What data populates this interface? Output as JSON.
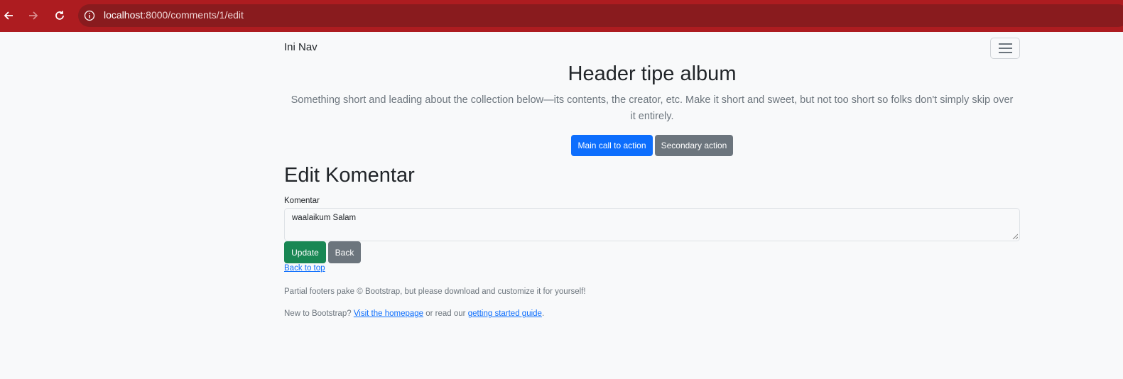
{
  "browser": {
    "url_host": "localhost",
    "url_path": ":8000/comments/1/edit"
  },
  "navbar": {
    "brand": "Ini Nav"
  },
  "hero": {
    "title": "Header tipe album",
    "lead_line1": "Something short and leading about the collection below—its contents, the creator, etc. Make it short and sweet, but not too short so folks don't simply skip over",
    "lead_line2": "it entirely.",
    "primary_label": "Main call to action",
    "secondary_label": "Secondary action"
  },
  "form": {
    "title": "Edit Komentar",
    "label": "Komentar",
    "value": "waalaikum Salam",
    "update_label": "Update",
    "back_label": "Back"
  },
  "footer": {
    "back_to_top": "Back to top",
    "line1": "Partial footers pake © Bootstrap, but please download and customize it for yourself!",
    "line2_prefix": "New to Bootstrap? ",
    "homepage_link": "Visit the homepage",
    "line2_middle": " or read our ",
    "guide_link": "getting started guide",
    "line2_suffix": "."
  },
  "colors": {
    "chrome": "#ad1c20",
    "primary": "#0d6efd",
    "secondary": "#6c757d",
    "success": "#198754"
  }
}
